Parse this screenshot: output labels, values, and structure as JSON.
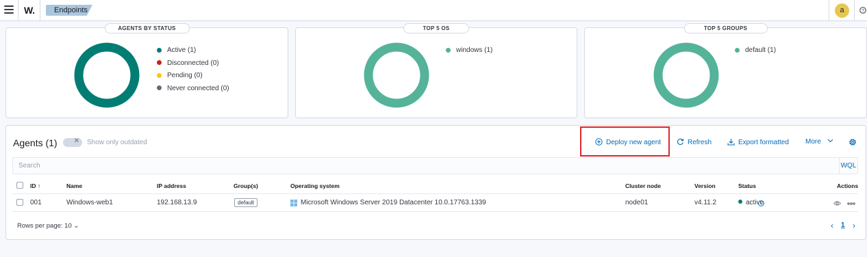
{
  "header": {
    "logo": "W.",
    "breadcrumb": "Endpoints",
    "avatar_initial": "a"
  },
  "cards": [
    {
      "title": "AGENTS BY STATUS",
      "ring_color": "#017d73",
      "legend": [
        {
          "label": "Active (1)",
          "color": "#017d73"
        },
        {
          "label": "Disconnected (0)",
          "color": "#bd271e"
        },
        {
          "label": "Pending (0)",
          "color": "#fec514"
        },
        {
          "label": "Never connected (0)",
          "color": "#646a77"
        }
      ]
    },
    {
      "title": "TOP 5 OS",
      "ring_color": "#54b399",
      "legend": [
        {
          "label": "windows (1)",
          "color": "#54b399"
        }
      ]
    },
    {
      "title": "TOP 5 GROUPS",
      "ring_color": "#54b399",
      "legend": [
        {
          "label": "default (1)",
          "color": "#54b399"
        }
      ]
    }
  ],
  "agents": {
    "title": "Agents (1)",
    "outdated_toggle_label": "Show only outdated",
    "actions": {
      "deploy": "Deploy new agent",
      "refresh": "Refresh",
      "export": "Export formatted",
      "more": "More"
    },
    "search_placeholder": "Search",
    "wql_label": "WQL",
    "columns": {
      "id": "ID",
      "name": "Name",
      "ip": "IP address",
      "groups": "Group(s)",
      "os": "Operating system",
      "cluster": "Cluster node",
      "version": "Version",
      "status": "Status",
      "actions": "Actions"
    },
    "rows": [
      {
        "id": "001",
        "name": "Windows-web1",
        "ip": "192.168.13.9",
        "group": "default",
        "os": "Microsoft Windows Server 2019 Datacenter 10.0.17763.1339",
        "cluster": "node01",
        "version": "v4.11.2",
        "status": "active"
      }
    ],
    "rows_per_page": "Rows per page: 10",
    "current_page": "1"
  }
}
